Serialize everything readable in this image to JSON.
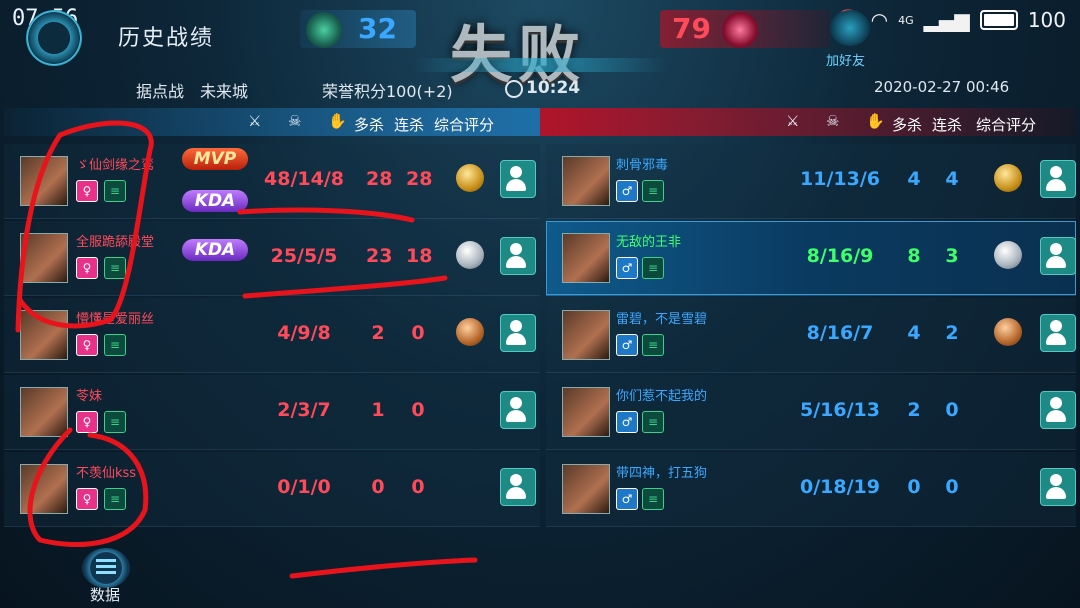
{
  "status_bar": {
    "time": "07:56",
    "network": "4G",
    "battery": "100"
  },
  "header": {
    "title": "历史战绩",
    "blue_score": "32",
    "red_score": "79",
    "result": "失败",
    "add_friend": "加好友"
  },
  "info": {
    "mode": "据点战",
    "map": "未来城",
    "honor": "荣誉积分100(+2)",
    "duration": "10:24",
    "datetime": "2020-02-27 00:46"
  },
  "columns": {
    "multikill": "多杀",
    "streak": "连杀",
    "rating": "综合评分"
  },
  "blue_team": [
    {
      "name": "ゞ仙剑缘之鸾",
      "kda": "48/14/8",
      "multikill": "28",
      "streak": "28",
      "medal": "gold",
      "mvp": "MVP",
      "kda_badge": "KDA"
    },
    {
      "name": "全服跪舔殿堂",
      "kda": "25/5/5",
      "multikill": "23",
      "streak": "18",
      "medal": "silver",
      "kda_badge": "KDA"
    },
    {
      "name": "懵懂是爱丽丝",
      "kda": "4/9/8",
      "multikill": "2",
      "streak": "0",
      "medal": "bronze"
    },
    {
      "name": "苓妹",
      "kda": "2/3/7",
      "multikill": "1",
      "streak": "0",
      "medal": ""
    },
    {
      "name": "不羡仙kss",
      "kda": "0/1/0",
      "multikill": "0",
      "streak": "0",
      "medal": ""
    }
  ],
  "red_team": [
    {
      "name": "刺骨邪毒",
      "kda": "11/13/6",
      "multikill": "4",
      "streak": "4",
      "medal": "gold"
    },
    {
      "name": "无敌的王非",
      "kda": "8/16/9",
      "multikill": "8",
      "streak": "3",
      "medal": "silver"
    },
    {
      "name": "雷碧，不是雪碧",
      "kda": "8/16/7",
      "multikill": "4",
      "streak": "2",
      "medal": "bronze"
    },
    {
      "name": "你们惹不起我的",
      "kda": "5/16/13",
      "multikill": "2",
      "streak": "0",
      "medal": ""
    },
    {
      "name": "带四神，打五狗",
      "kda": "0/18/19",
      "multikill": "0",
      "streak": "0",
      "medal": ""
    }
  ],
  "bottom": {
    "data_label": "数据"
  },
  "colors": {
    "blue_text": "#3aa8ff",
    "red_text": "#ff4a5a",
    "highlight_text": "#3cff6a"
  }
}
